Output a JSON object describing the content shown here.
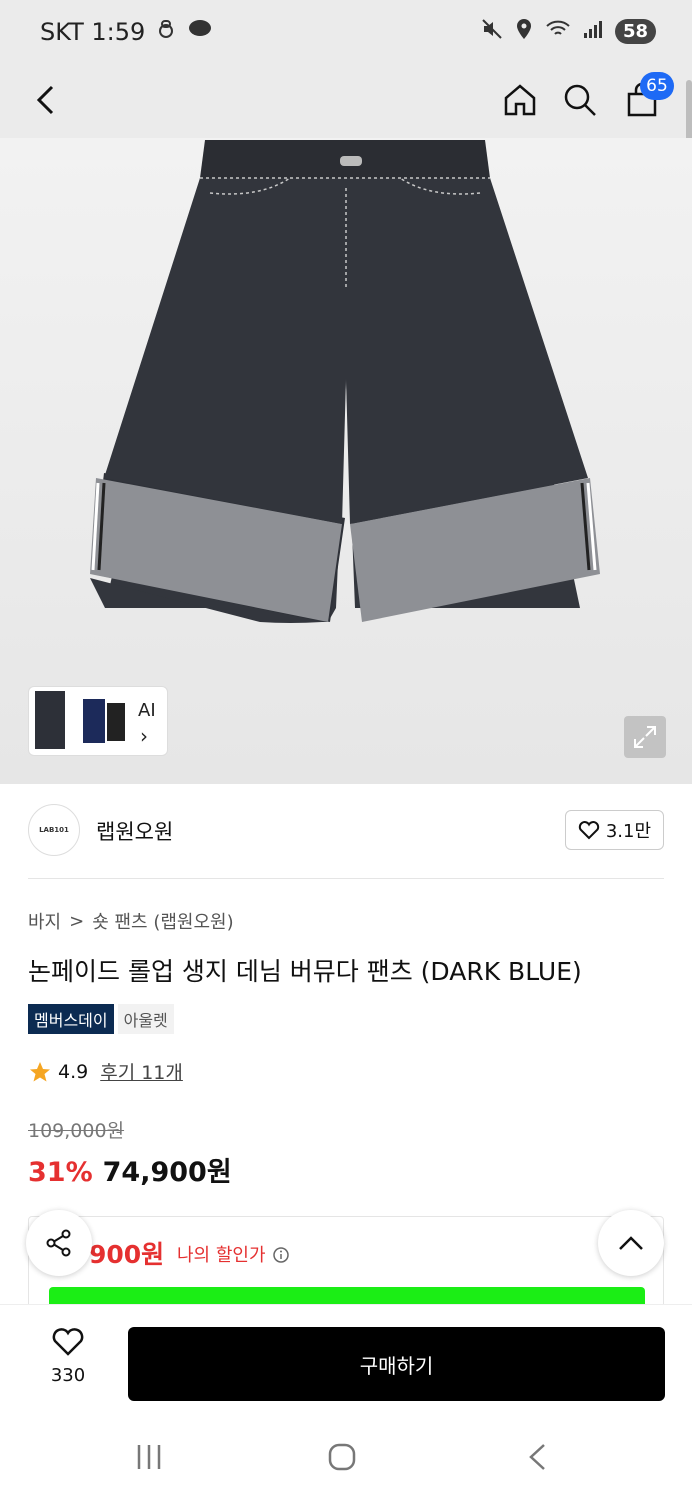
{
  "status": {
    "carrier_time": "SKT 1:59",
    "battery": "58"
  },
  "nav": {
    "cart_count": "65"
  },
  "hero": {
    "ai_label": "AI",
    "ai_chevron": "›"
  },
  "brand": {
    "logo_text": "LAB101",
    "name": "랩원오원",
    "likes": "3.1만"
  },
  "breadcrumb": {
    "category": "바지",
    "separator": ">",
    "subcategory": "숏 팬츠 (랩원오원)"
  },
  "product": {
    "title": "논페이드 롤업 생지 데님 버뮤다 팬츠 (DARK BLUE)",
    "tags": [
      "멤버스데이",
      "아울렛"
    ],
    "rating": "4.9",
    "reviews": "후기 11개",
    "original_price": "109,000원",
    "discount": "31%",
    "sale_price": "74,900원"
  },
  "coupon": {
    "my_price": "900원",
    "my_label": "나의 할인가"
  },
  "bottom": {
    "wish_count": "330",
    "buy_label": "구매하기"
  },
  "colors": {
    "discount_red": "#e53030",
    "badge_blue": "#1e6af5",
    "tag_navy": "#0c2b52",
    "promo_green": "#1bee15"
  }
}
